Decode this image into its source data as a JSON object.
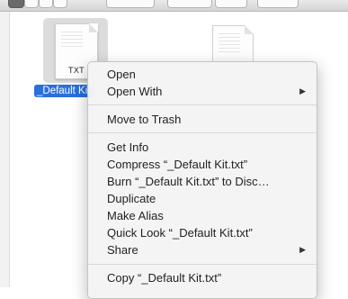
{
  "file_selected": {
    "extension": "TXT",
    "label": "_Default Ki"
  },
  "context_menu": {
    "items": [
      {
        "label": "Open"
      },
      {
        "label": "Open With",
        "submenu": true
      },
      {
        "label": "Move to Trash"
      },
      {
        "label": "Get Info"
      },
      {
        "label": "Compress “_Default Kit.txt”"
      },
      {
        "label": "Burn “_Default Kit.txt” to Disc…"
      },
      {
        "label": "Duplicate"
      },
      {
        "label": "Make Alias"
      },
      {
        "label": "Quick Look “_Default Kit.txt”"
      },
      {
        "label": "Share",
        "submenu": true
      },
      {
        "label": "Copy “_Default Kit.txt”"
      }
    ],
    "submenu_arrow": "▶"
  },
  "colors": {
    "selection": "#2a6fdc",
    "menu_background": "#f4f4f4"
  }
}
